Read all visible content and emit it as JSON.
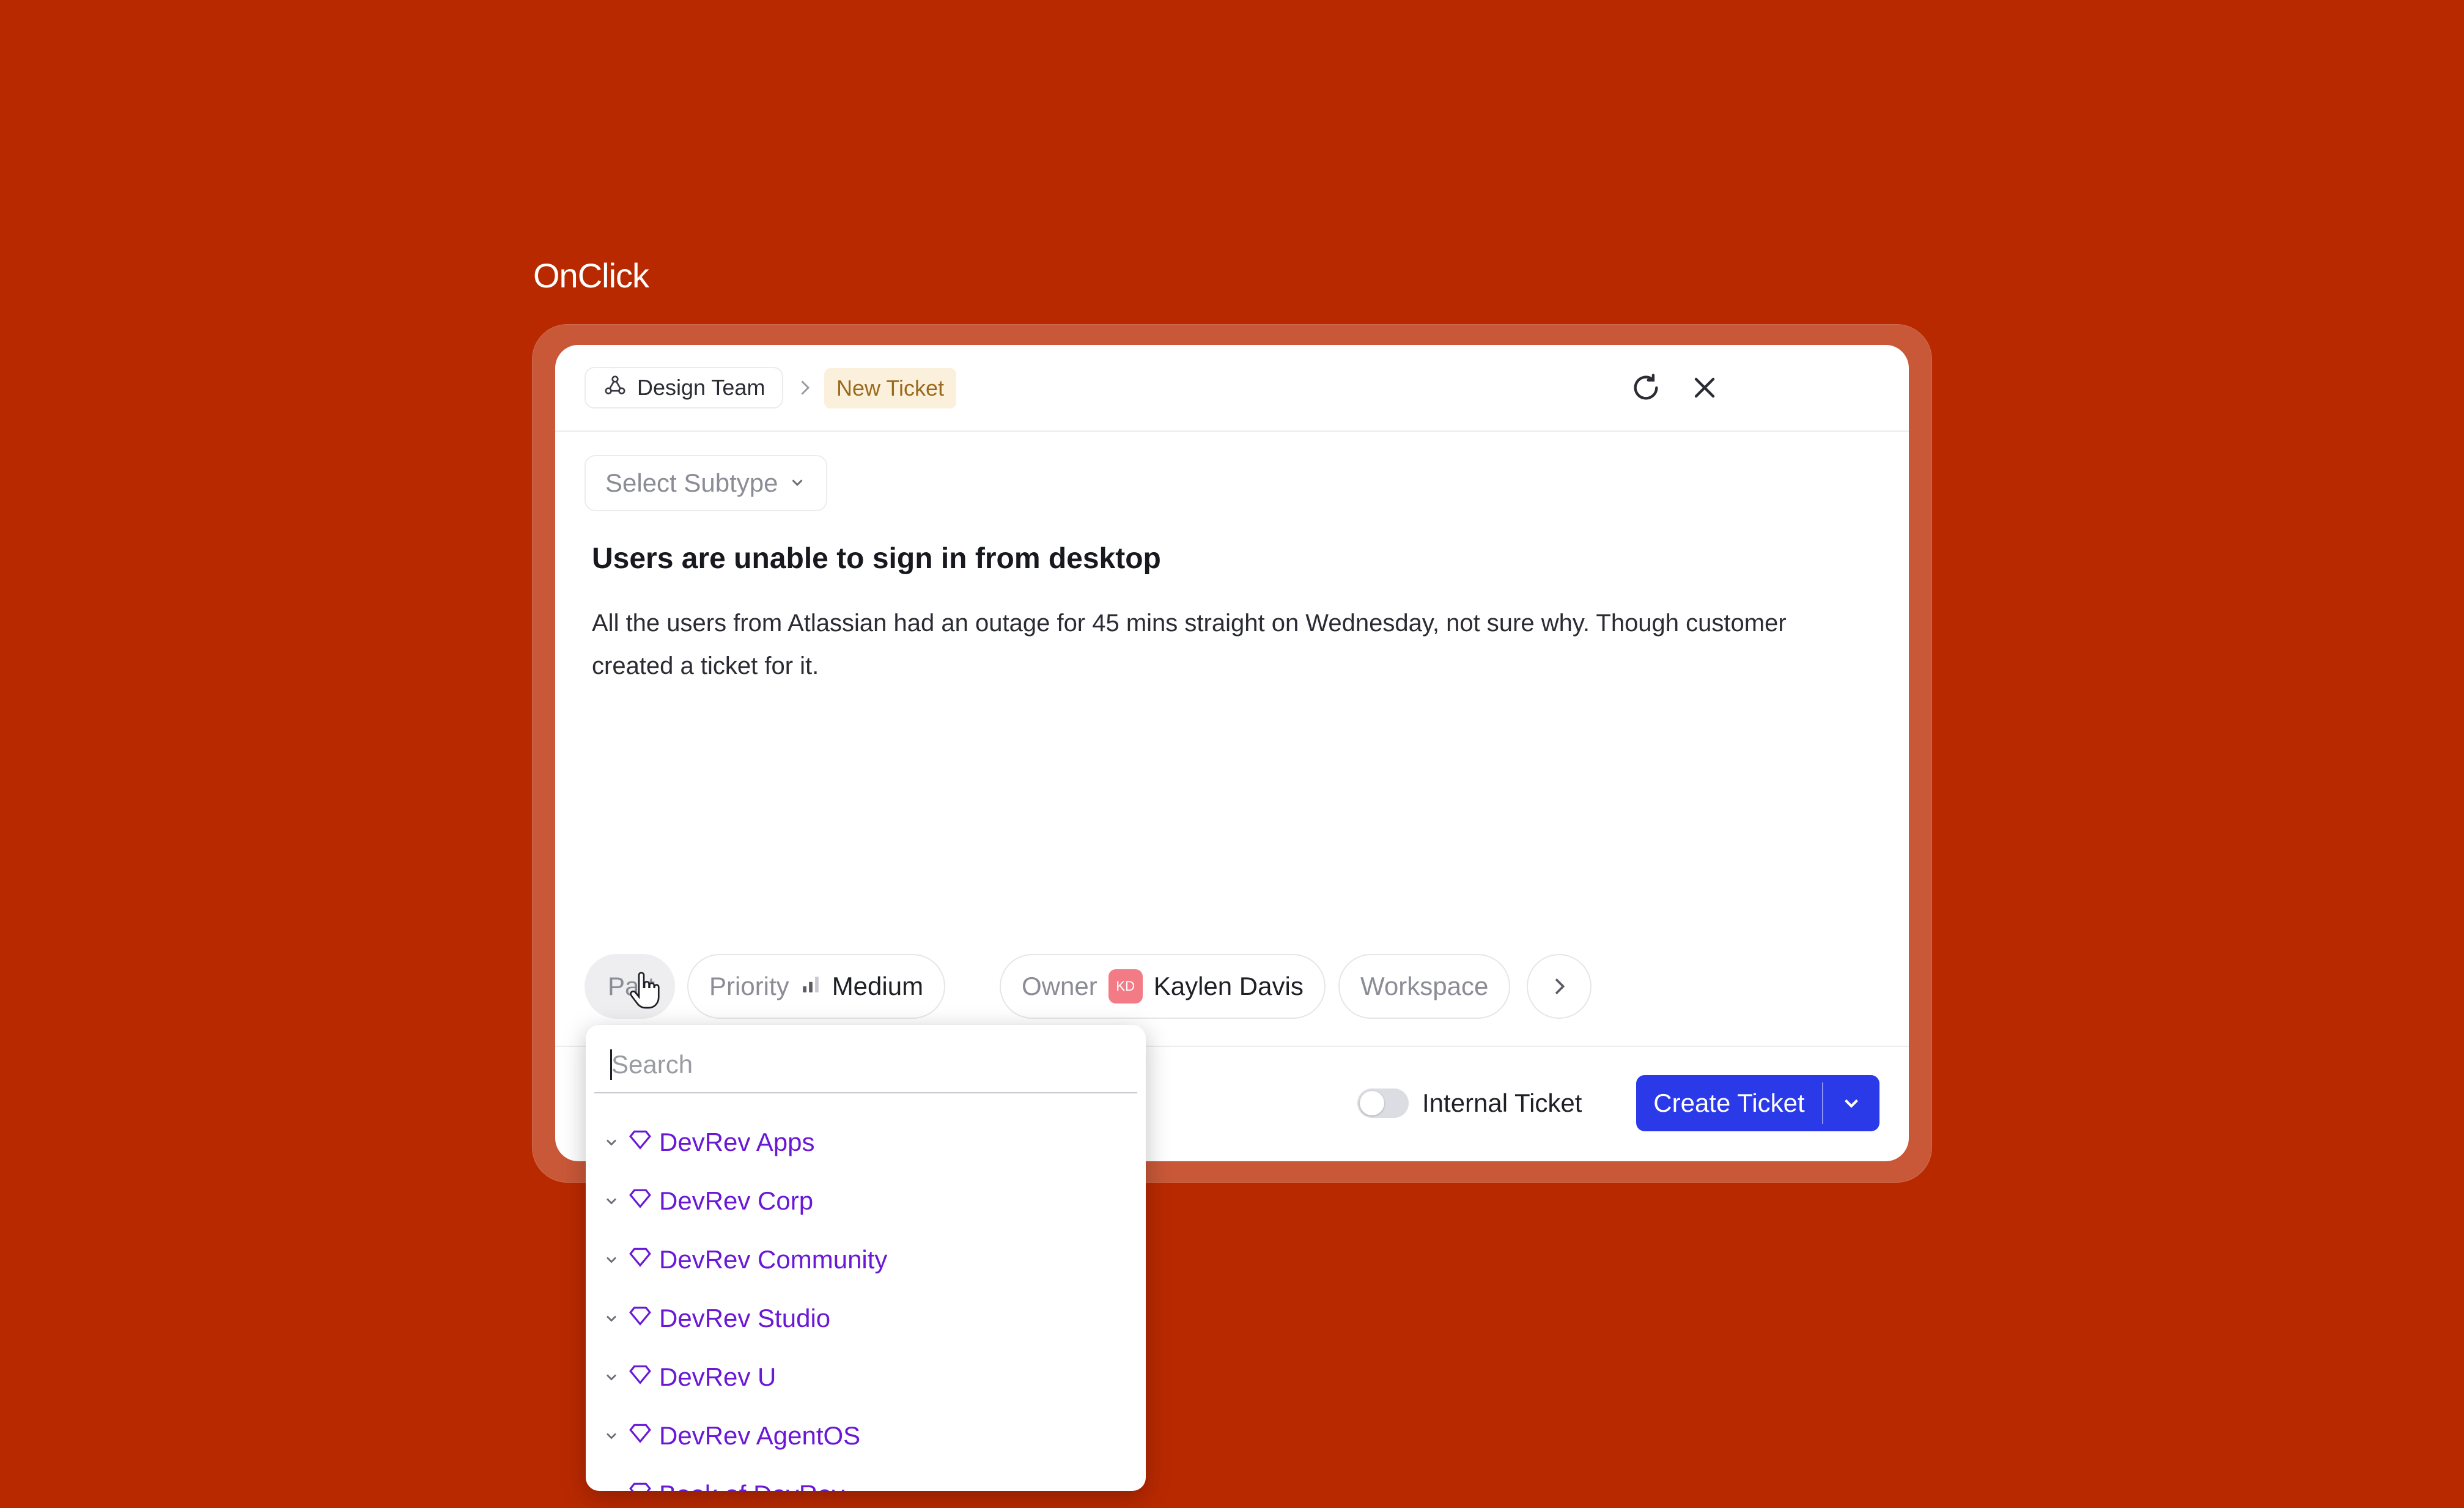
{
  "brand": "OnClick",
  "header": {
    "team": "Design Team",
    "current": "New Ticket"
  },
  "subtype": {
    "placeholder": "Select Subtype"
  },
  "ticket": {
    "title": "Users are unable to sign in from desktop",
    "description": "All the users from Atlassian had an outage for 45 mins straight on Wednesday, not sure why. Though customer created a ticket for it."
  },
  "chips": {
    "part": "Part",
    "priority_label": "Priority",
    "priority_value": "Medium",
    "owner_label": "Owner",
    "owner_initials": "KD",
    "owner_name": "Kaylen Davis",
    "workspace": "Workspace"
  },
  "footer": {
    "internal_label": "Internal Ticket",
    "internal_on": false,
    "create_label": "Create Ticket"
  },
  "dropdown": {
    "search_placeholder": "Search",
    "items": [
      {
        "label": "DevRev Apps"
      },
      {
        "label": "DevRev Corp"
      },
      {
        "label": "DevRev Community"
      },
      {
        "label": "DevRev Studio"
      },
      {
        "label": "DevRev U"
      },
      {
        "label": "DevRev AgentOS"
      },
      {
        "label": "Book of DevRev"
      }
    ]
  },
  "colors": {
    "background": "#b92900",
    "accent": "#2b3ae8",
    "part_link": "#6a18d6"
  }
}
